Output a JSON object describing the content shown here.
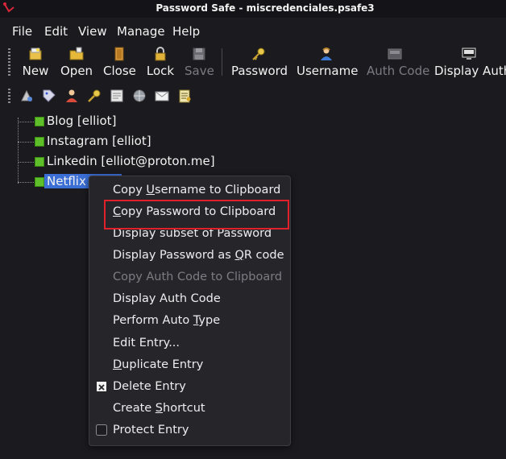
{
  "window": {
    "title": "Password Safe - miscredenciales.psafe3"
  },
  "menu": [
    "File",
    "Edit",
    "View",
    "Manage",
    "Help"
  ],
  "toolbar": {
    "new": "New",
    "open": "Open",
    "close": "Close",
    "lock": "Lock",
    "save": "Save",
    "password": "Password",
    "username": "Username",
    "auth_code": "Auth Code",
    "display_auth": "Display Auth"
  },
  "tree": {
    "items": [
      "Blog [elliot]",
      "Instagram [elliot]",
      "Linkedin [elliot@proton.me]",
      "Netflix ["
    ]
  },
  "context_menu": {
    "copy_username": {
      "pre": "Copy ",
      "key": "U",
      "post": "sername to Clipboard"
    },
    "copy_password": {
      "pre": "",
      "key": "C",
      "post": "opy Password to Clipboard"
    },
    "display_subset": "Display subset of Password",
    "display_qr": {
      "pre": "Display Password as ",
      "key": "Q",
      "post": "R code"
    },
    "copy_auth": "Copy Auth Code to Clipboard",
    "display_auth_code": "Display Auth Code",
    "auto_type": {
      "pre": "Perform Auto ",
      "key": "T",
      "post": "ype"
    },
    "edit_entry": "Edit Entry...",
    "duplicate": {
      "pre": "",
      "key": "D",
      "post": "uplicate Entry"
    },
    "delete": "Delete Entry",
    "shortcut": {
      "pre": "Create ",
      "key": "S",
      "post": "hortcut"
    },
    "protect": "Protect Entry"
  },
  "colors": {
    "background": "#1b1b1f",
    "selection": "#3b6fd6",
    "highlight_border": "#e0202a",
    "leaf": "#5fbf2a"
  }
}
